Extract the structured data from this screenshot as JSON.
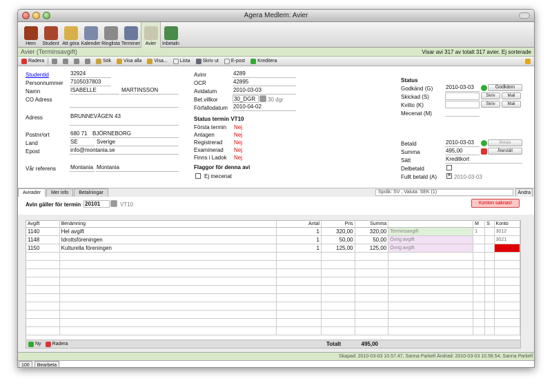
{
  "window": {
    "title": "Agera Medlem: Avier"
  },
  "iconbar": [
    {
      "label": "Hem",
      "icon": "home-icon",
      "color": "#9a3b1e"
    },
    {
      "label": "Student",
      "icon": "student-icon",
      "color": "#a8452c"
    },
    {
      "label": "Att göra",
      "icon": "todo-icon",
      "color": "#d8b04a"
    },
    {
      "label": "Kalender",
      "icon": "calendar-icon",
      "color": "#7a8aa8"
    },
    {
      "label": "Ringlista",
      "icon": "phone-list-icon",
      "color": "#8a8a8a"
    },
    {
      "label": "Terminer",
      "icon": "terms-icon",
      "color": "#6a7a9a"
    },
    {
      "label": "Avier",
      "icon": "invoice-icon",
      "color": "#c8c8b0"
    },
    {
      "label": "Inbetaln",
      "icon": "payment-icon",
      "color": "#4a8a4a"
    }
  ],
  "header": {
    "title": "Avier (Terminsavgift)",
    "info": "Visar avi 317 av totalt 317 avier. Ej sorterade"
  },
  "toolbar": {
    "delete": "Radera",
    "search": "Sök",
    "show_all": "Visa alla",
    "show": "Visa...",
    "list": "Lista",
    "print": "Skriv ut",
    "email": "E-post",
    "credit": "Kreditera"
  },
  "student": {
    "id_label": "Studentid",
    "id": "32924",
    "pnr_label": "Personnummer",
    "pnr": "7105037803",
    "name_label": "Namn",
    "first": "ISABELLE",
    "last": "MARTINSSON",
    "co_label": "CO Adress",
    "co": "",
    "addr_label": "Adress",
    "addr": "BRUNNEVÄGEN 43",
    "zip_label": "Postnr/ort",
    "zip": "680 71",
    "city": "BJÖRNEBORG",
    "country_label": "Land",
    "cc": "SE",
    "country": "Sverige",
    "email_label": "Epost",
    "email": "info@montania.se",
    "ref_label": "Vår referens",
    "ref1": "Montania",
    "ref2": "Montania"
  },
  "invoice": {
    "avinr_label": "Avinr",
    "avinr": "4289",
    "ocr_label": "OCR",
    "ocr": "42895",
    "date_label": "Avidatum",
    "date": "2010-03-03",
    "terms_label": "Bet.villkor",
    "terms": "30_DGR",
    "terms_days": "30 dgr",
    "due_label": "Förfallodatum",
    "due": "2010-04-02"
  },
  "term_status": {
    "title": "Status termin VT10",
    "rows": [
      [
        "Första termin",
        "Nej"
      ],
      [
        "Antagen",
        "Nej"
      ],
      [
        "Registrerad",
        "Nej"
      ],
      [
        "Examinerad",
        "Nej"
      ],
      [
        "Finns i Ladok",
        "Nej"
      ]
    ]
  },
  "flags": {
    "title": "Flaggor för denna avi",
    "mecenat": "Ej mecenat"
  },
  "status": {
    "title": "Status",
    "approved_label": "Godkänd",
    "approved_key": "(G)",
    "approved": "2010-03-03",
    "approve_btn": "Godkänn",
    "sent_label": "Skickad",
    "sent_key": "(S)",
    "receipt_label": "Kvitto",
    "receipt_key": "(K)",
    "mecenat_label": "Mecenat",
    "mecenat_key": "(M)",
    "write_btn": "Skriv",
    "mail_btn": "Mail"
  },
  "payment": {
    "paid_label": "Betald",
    "paid": "2010-03-03",
    "pay_btn": "Betala",
    "sum_label": "Summa",
    "sum": "495,00",
    "reset_btn": "Återställ",
    "method_label": "Sätt",
    "method": "Kreditkort",
    "partial_label": "Delbetald",
    "full_label": "Fullt betald",
    "full_key": "(A)",
    "full_date": "2010-03-03"
  },
  "tabs": [
    "Avirader",
    "Mer info",
    "Betalningar"
  ],
  "lang": {
    "text": "Språk: SV , Valuta: SEK (1)",
    "edit": "Ändra"
  },
  "term": {
    "label": "Avin gäller för termin",
    "value": "20101",
    "name": "VT10",
    "alert": "Konton saknas!"
  },
  "grid": {
    "headers": [
      "Avgift",
      "Benämning",
      "Antal",
      "Pris",
      "Summa",
      "",
      "M",
      "S",
      "Konto"
    ],
    "rows": [
      [
        "1140",
        "Hel avgift",
        "1",
        "320,00",
        "320,00",
        "Terminsavgift",
        "1",
        "",
        "3012"
      ],
      [
        "1148",
        "Idrottsföreningen",
        "1",
        "50,00",
        "50,00",
        "Övrig avgift",
        "",
        "",
        "3021"
      ],
      [
        "1150",
        "Kulturella föreningen",
        "1",
        "125,00",
        "125,00",
        "Övrig avgift",
        "",
        "",
        ""
      ]
    ],
    "new_btn": "Ny",
    "delete_btn": "Radera",
    "total_label": "Totalt",
    "total": "495,00"
  },
  "footer": {
    "meta": "Skapad: 2010-03-03 10.57.47, Sanna Parkell Ändrad: 2010-03-03 10.58.54, Sanna Parkell",
    "zoom": "100",
    "mode": "Bearbeta"
  }
}
